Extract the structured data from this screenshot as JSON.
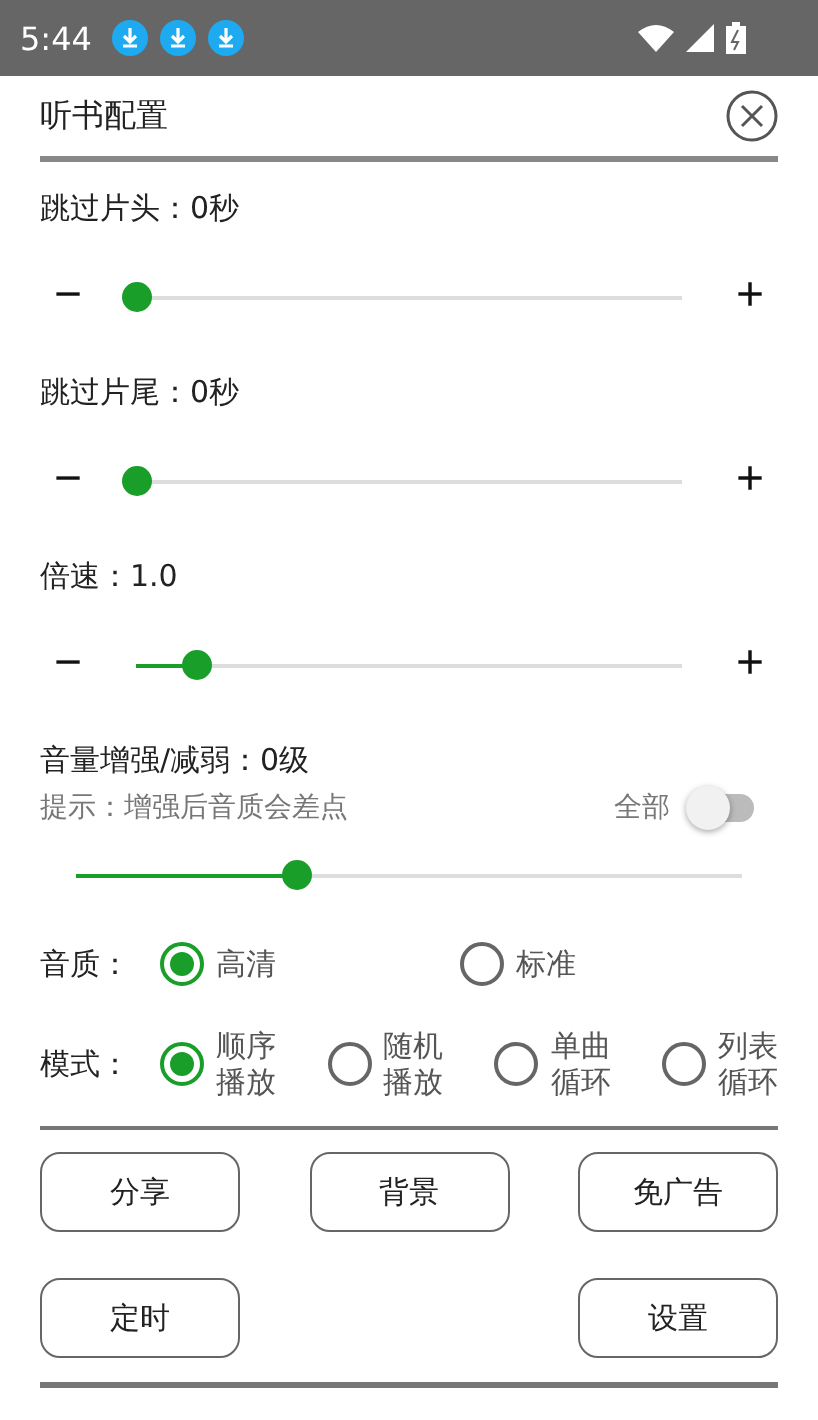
{
  "status_bar": {
    "time": "5:44",
    "notification_icons": [
      {
        "kind": "download"
      },
      {
        "kind": "download"
      },
      {
        "kind": "download"
      }
    ]
  },
  "title": "听书配置",
  "sliders": [
    {
      "label": "跳过片头：0秒",
      "minus": "−",
      "plus": "+",
      "level": 0
    },
    {
      "label": "跳过片尾：0秒",
      "minus": "−",
      "plus": "+",
      "level": 0
    },
    {
      "label": "倍速：1.0",
      "minus": "−",
      "plus": "+",
      "level": 0.11
    }
  ],
  "volume": {
    "label": "音量增强/减弱：0级",
    "hint": "提示：增强后音质会差点",
    "toggle_label": "全部",
    "toggle_on": false,
    "level": 0.33
  },
  "quality": {
    "label": "音质：",
    "options": [
      {
        "label": "高清",
        "selected": true
      },
      {
        "label": "标准",
        "selected": false
      }
    ]
  },
  "mode": {
    "label": "模式：",
    "options": [
      {
        "label": "顺序播放",
        "selected": true
      },
      {
        "label": "随机播放",
        "selected": false
      },
      {
        "label": "单曲循环",
        "selected": false
      },
      {
        "label": "列表循环",
        "selected": false
      }
    ]
  },
  "buttons": [
    [
      "分享",
      "背景",
      "免广告"
    ],
    [
      "定时",
      "设置"
    ]
  ]
}
